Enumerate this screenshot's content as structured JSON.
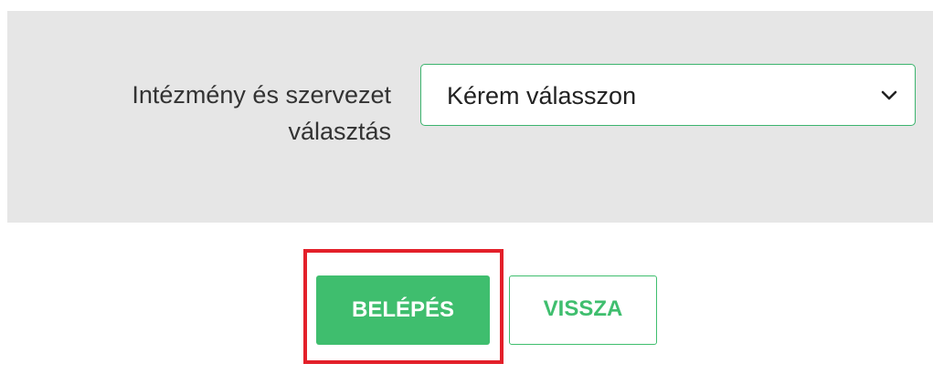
{
  "form": {
    "label_line1": "Intézmény és szervezet",
    "label_line2": "választás",
    "select_value": "Kérem válasszon",
    "select_icon": "chevron-down-icon"
  },
  "buttons": {
    "login_label": "BELÉPÉS",
    "back_label": "VISSZA"
  },
  "colors": {
    "accent": "#3fbe6e",
    "highlight": "#e3202a",
    "panel_bg": "#e6e6e6"
  }
}
